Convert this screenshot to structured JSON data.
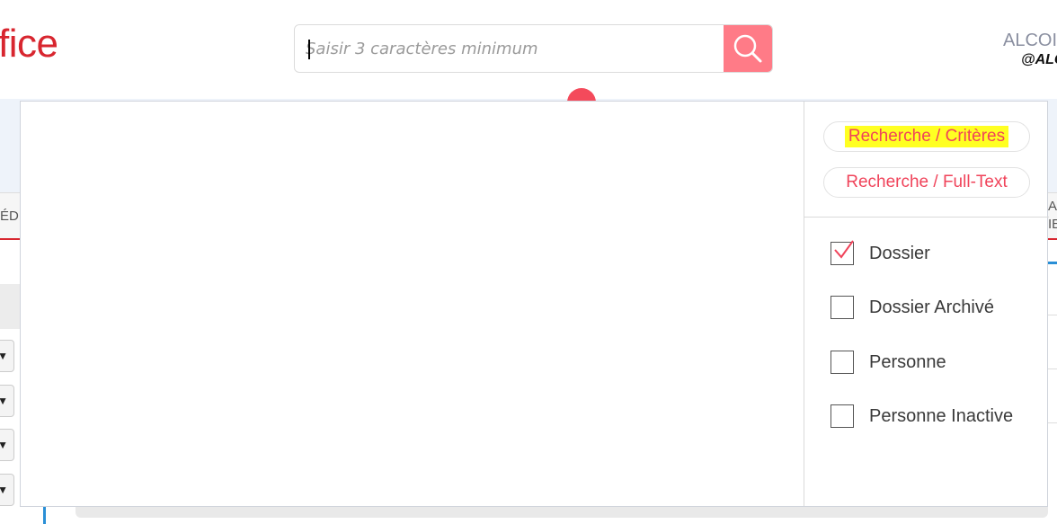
{
  "header": {
    "logo_text": "fice",
    "search": {
      "placeholder": "Saisir 3 caractères minimum",
      "value": ""
    },
    "user": {
      "name": "ALCOI",
      "handle": "@ALC"
    }
  },
  "background": {
    "left_text": "ÉD",
    "right_text_line1": "AU",
    "right_text_line2": "IE"
  },
  "dropdown": {
    "modes": [
      {
        "label": "Recherche / Critères",
        "active": true
      },
      {
        "label": "Recherche / Full-Text",
        "active": false
      }
    ],
    "filters": [
      {
        "label": "Dossier",
        "checked": true
      },
      {
        "label": "Dossier Archivé",
        "checked": false
      },
      {
        "label": "Personne",
        "checked": false
      },
      {
        "label": "Personne Inactive",
        "checked": false
      }
    ]
  },
  "colors": {
    "brand": "#d8262f",
    "accent": "#f0435a",
    "search_button": "#ff7b87",
    "highlight": "#ffff22"
  }
}
